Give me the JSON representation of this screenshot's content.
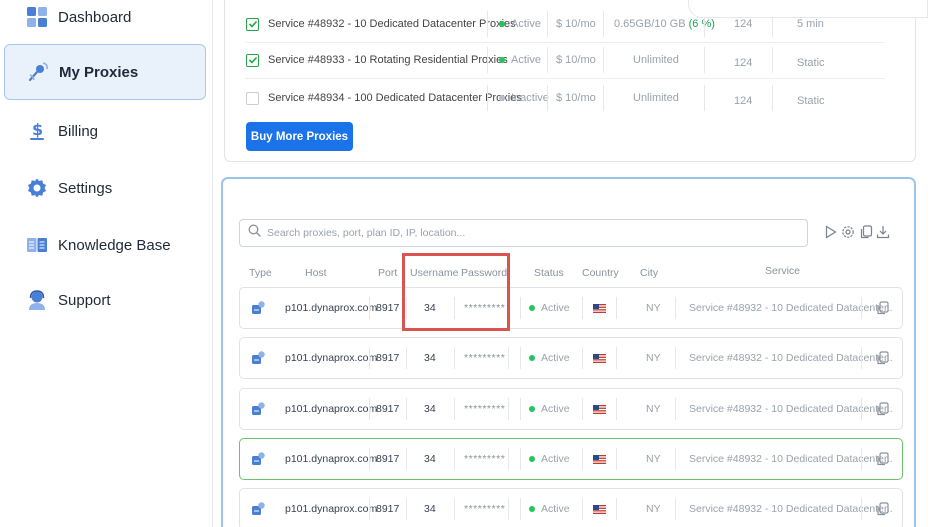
{
  "sidebar": {
    "items": [
      {
        "label": "Dashboard",
        "icon": "dashboard-icon",
        "active": false
      },
      {
        "label": "My Proxies",
        "icon": "satellite-icon",
        "active": true
      },
      {
        "label": "Billing",
        "icon": "dollar-icon",
        "active": false
      },
      {
        "label": "Settings",
        "icon": "gear-icon",
        "active": false
      },
      {
        "label": "Knowledge Base",
        "icon": "book-icon",
        "active": false
      },
      {
        "label": "Support",
        "icon": "support-agent-icon",
        "active": false
      }
    ]
  },
  "services": {
    "rows": [
      {
        "checked": true,
        "name": "Service #48932 - 10 Dedicated Datacenter Proxies",
        "status": "Active",
        "price": "$ 10/mo",
        "bandwidth": "0.65GB/10 GB",
        "bandwidth_pct": "(6 %)",
        "count": "124",
        "rotation": "5 min"
      },
      {
        "checked": true,
        "name": "Service #48933 - 10 Rotating Residential Proxies",
        "status": "Active",
        "price": "$ 10/mo",
        "bandwidth": "Unlimited",
        "bandwidth_pct": "",
        "count": "124",
        "rotation": "Static"
      },
      {
        "checked": false,
        "name": "Service #48934 - 100 Dedicated Datacenter Proxies",
        "status": "Inactive",
        "price": "$ 10/mo",
        "bandwidth": "Unlimited",
        "bandwidth_pct": "",
        "count": "124",
        "rotation": "Static"
      }
    ],
    "buy_label": "Buy More Proxies"
  },
  "proxies": {
    "search_placeholder": "Search proxies, port, plan ID, IP, location...",
    "tools": [
      "play-icon",
      "settings-cog-icon",
      "copy-icon",
      "download-icon"
    ],
    "headers": {
      "type": "Type",
      "host": "Host",
      "port": "Port",
      "username": "Username",
      "password": "Password",
      "status": "Status",
      "country": "Country",
      "city": "City",
      "service": "Service"
    },
    "rows": [
      {
        "host": "p101.dynaprox.com",
        "port": "8917",
        "username": "34",
        "password": "*********",
        "status": "Active",
        "country_flag": "us-flag-icon",
        "city": "NY",
        "service": "Service #48932 - 10 Dedicated Datacenter..",
        "highlight": false
      },
      {
        "host": "p101.dynaprox.com",
        "port": "8917",
        "username": "34",
        "password": "*********",
        "status": "Active",
        "country_flag": "us-flag-icon",
        "city": "NY",
        "service": "Service #48932 - 10 Dedicated Datacenter..",
        "highlight": false
      },
      {
        "host": "p101.dynaprox.com",
        "port": "8917",
        "username": "34",
        "password": "*********",
        "status": "Active",
        "country_flag": "us-flag-icon",
        "city": "NY",
        "service": "Service #48932 - 10 Dedicated Datacenter..",
        "highlight": false
      },
      {
        "host": "p101.dynaprox.com",
        "port": "8917",
        "username": "34",
        "password": "*********",
        "status": "Active",
        "country_flag": "us-flag-icon",
        "city": "NY",
        "service": "Service #48932 - 10 Dedicated Datacenter..",
        "highlight": true
      },
      {
        "host": "p101.dynaprox.com",
        "port": "8917",
        "username": "34",
        "password": "*********",
        "status": "Active",
        "country_flag": "us-flag-icon",
        "city": "NY",
        "service": "Service #48932 - 10 Dedicated Datacenter..",
        "highlight": false
      }
    ]
  },
  "colors": {
    "accent": "#1a73e8",
    "active": "#22c55e",
    "highlight_box": "#d9534f",
    "selected_row": "#69c36f"
  }
}
